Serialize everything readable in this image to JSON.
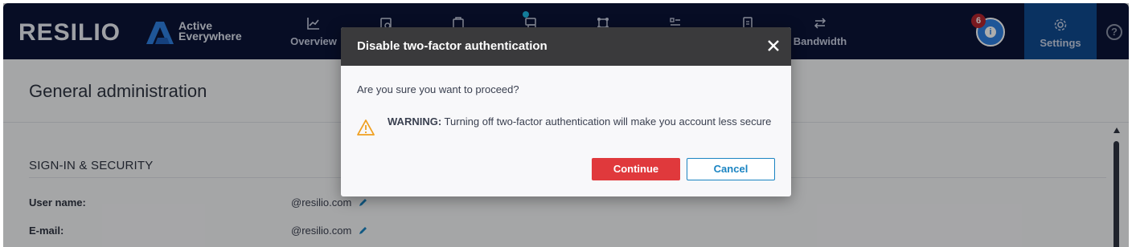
{
  "brand": {
    "name": "RESILIO",
    "product_line1": "Active",
    "product_line2": "Everywhere"
  },
  "nav": {
    "items": [
      {
        "label": "Overview",
        "icon": "chart-line-icon"
      },
      {
        "label": "",
        "icon": "jobs-icon"
      },
      {
        "label": "",
        "icon": "agents-icon"
      },
      {
        "label": "",
        "icon": "storage-icon"
      },
      {
        "label": "",
        "icon": "groups-icon"
      },
      {
        "label": "",
        "icon": "list-icon"
      },
      {
        "label": "",
        "icon": "reports-icon"
      },
      {
        "label": "Bandwidth",
        "icon": "arrows-swap-icon"
      }
    ],
    "notification_count": "6",
    "settings_label": "Settings",
    "help_glyph": "?"
  },
  "page": {
    "title": "General administration",
    "section_title": "SIGN-IN & SECURITY",
    "fields": [
      {
        "label": "User name:",
        "value": "@resilio.com"
      },
      {
        "label": "E-mail:",
        "value": "@resilio.com"
      }
    ]
  },
  "modal": {
    "title": "Disable two-factor authentication",
    "question": "Are you sure you want to proceed?",
    "warning_prefix": "WARNING:",
    "warning_text": " Turning off two-factor authentication will make you account less secure",
    "continue_label": "Continue",
    "cancel_label": "Cancel"
  },
  "colors": {
    "topbar": "#0b1437",
    "settings_tab": "#0f4a8f",
    "continue": "#e0393c",
    "cancel": "#1a84c2",
    "warning_icon": "#f0a020",
    "badge": "#b3262f"
  }
}
